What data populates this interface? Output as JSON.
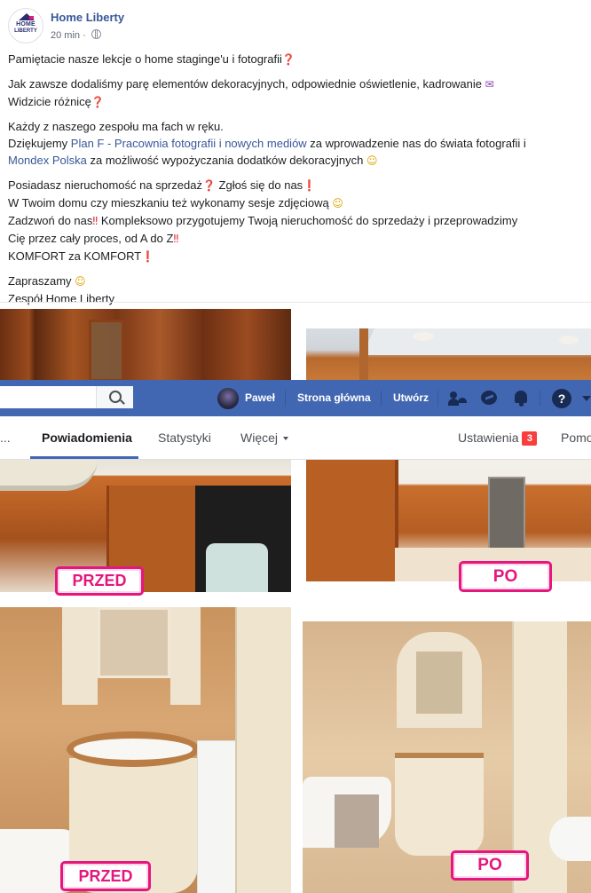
{
  "post": {
    "page_name": "Home Liberty",
    "logo_line1": "HOME",
    "logo_line2": "LIBERTY",
    "time": "20 min",
    "dot": "·",
    "p1": "Pamiętacie nasze lekcje o home staginge'u i fotografii",
    "p2a": "Jak zawsze dodaliśmy parę elementów dekoracyjnych, odpowiednie oświetlenie, kadrowanie",
    "p2b": "Widzicie różnicę",
    "p3a": "Każdy z naszego zespołu ma fach w ręku.",
    "p3b_pre": "Dziękujemy ",
    "p3b_link": "Plan F - Pracownia fotografii i nowych mediów",
    "p3b_post": " za wprowadzenie nas do świata fotografii i",
    "p3c_link": "Mondex Polska",
    "p3c_post": " za możliwość wypożyczania dodatków dekoracyjnych",
    "p4a_1": "Posiadasz nieruchomość na sprzedaż",
    "p4a_2": " Zgłoś się do nas",
    "p4b": "W Twoim domu czy mieszkaniu też wykonamy sesje zdjęciową",
    "p4c_1": "Zadzwoń do nas",
    "p4c_2": " Kompleksowo przygotujemy Twoją nieruchomość do sprzedaży i przeprowadzimy",
    "p4d": "Cię przez cały proces, od A do Z",
    "p4e": "KOMFORT za KOMFORT",
    "p5a": "Zapraszamy",
    "p5b": "Zespół Home Liberty"
  },
  "emoji": {
    "question": "❓",
    "exclaim": "❗",
    "double_exclaim": "‼",
    "smile": "☺",
    "ribbon": "✉"
  },
  "photos": {
    "before_label": "PRZED",
    "after_label": "PO"
  },
  "navbar": {
    "user": "Paweł",
    "home": "Strona główna",
    "create": "Utwórz",
    "help": "?"
  },
  "tabs": {
    "ellipsis": "...",
    "notifications": "Powiadomienia",
    "stats": "Statystyki",
    "more": "Więcej",
    "settings": "Ustawienia",
    "settings_badge": "3",
    "help_cut": "Pomo"
  },
  "colors": {
    "facebook_blue": "#4267b2",
    "link": "#385898",
    "badge_pink": "#e4177e",
    "notification_red": "#fa3e3e"
  }
}
